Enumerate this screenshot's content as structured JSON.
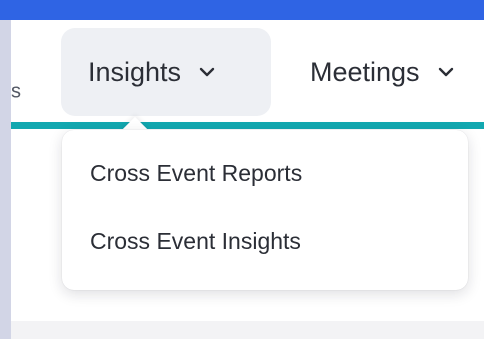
{
  "nav": {
    "partial_left_label": "s",
    "tabs": [
      {
        "label": "Insights",
        "active": true,
        "icon": "chevron-down-icon"
      },
      {
        "label": "Meetings",
        "active": false,
        "icon": "chevron-down-icon"
      }
    ]
  },
  "insights_menu": {
    "items": [
      {
        "label": "Cross Event Reports"
      },
      {
        "label": "Cross Event Insights"
      }
    ]
  },
  "colors": {
    "top_bar": "#2f64e4",
    "accent_line": "#12a8b0",
    "active_tab_bg": "#eef0f4",
    "text": "#2b2e36",
    "left_strip": "#d2d5e6"
  }
}
